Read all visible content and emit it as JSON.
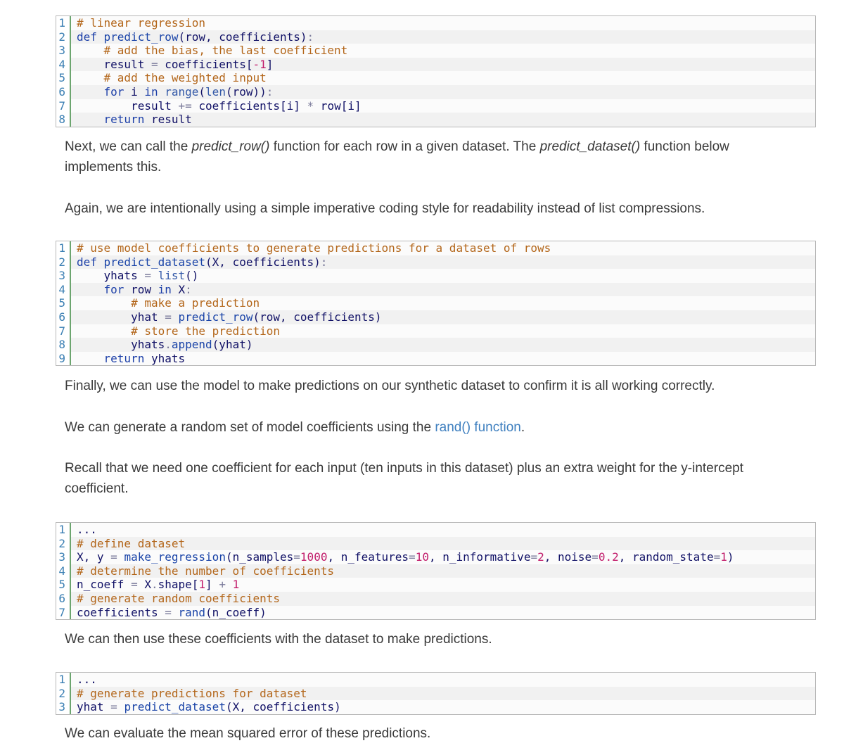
{
  "code_block_1": {
    "lines": [
      {
        "n": "1",
        "tokens": [
          {
            "t": "# linear regression",
            "c": "c"
          }
        ]
      },
      {
        "n": "2",
        "tokens": [
          {
            "t": "def ",
            "c": "k"
          },
          {
            "t": "predict_row",
            "c": "fn"
          },
          {
            "t": "(row, coefficients)",
            "c": "nm"
          },
          {
            "t": ":",
            "c": "p"
          }
        ]
      },
      {
        "n": "3",
        "tokens": [
          {
            "t": "    ",
            "c": "nm"
          },
          {
            "t": "# add the bias, the last coefficient",
            "c": "c"
          }
        ]
      },
      {
        "n": "4",
        "tokens": [
          {
            "t": "    result ",
            "c": "nm"
          },
          {
            "t": "=",
            "c": "p"
          },
          {
            "t": " coefficients[",
            "c": "nm"
          },
          {
            "t": "-1",
            "c": "num"
          },
          {
            "t": "]",
            "c": "nm"
          }
        ]
      },
      {
        "n": "5",
        "tokens": [
          {
            "t": "    ",
            "c": "nm"
          },
          {
            "t": "# add the weighted input",
            "c": "c"
          }
        ]
      },
      {
        "n": "6",
        "tokens": [
          {
            "t": "    ",
            "c": "nm"
          },
          {
            "t": "for ",
            "c": "k"
          },
          {
            "t": "i ",
            "c": "nm"
          },
          {
            "t": "in ",
            "c": "k"
          },
          {
            "t": "range",
            "c": "b"
          },
          {
            "t": "(",
            "c": "nm"
          },
          {
            "t": "len",
            "c": "b"
          },
          {
            "t": "(row))",
            "c": "nm"
          },
          {
            "t": ":",
            "c": "p"
          }
        ]
      },
      {
        "n": "7",
        "tokens": [
          {
            "t": "        result ",
            "c": "nm"
          },
          {
            "t": "+=",
            "c": "p"
          },
          {
            "t": " coefficients[i] ",
            "c": "nm"
          },
          {
            "t": "*",
            "c": "p"
          },
          {
            "t": " row[i]",
            "c": "nm"
          }
        ]
      },
      {
        "n": "8",
        "tokens": [
          {
            "t": "    ",
            "c": "nm"
          },
          {
            "t": "return ",
            "c": "k"
          },
          {
            "t": "result",
            "c": "nm"
          }
        ]
      }
    ]
  },
  "paragraphs_1": {
    "p1_before1": "Next, we can call the ",
    "p1_em1": "predict_row()",
    "p1_mid": " function for each row in a given dataset. The ",
    "p1_em2": "predict_dataset()",
    "p1_after": " function below implements this.",
    "p2": "Again, we are intentionally using a simple imperative coding style for readability instead of list compressions."
  },
  "code_block_2": {
    "lines": [
      {
        "n": "1",
        "tokens": [
          {
            "t": "# use model coefficients to generate predictions for a dataset of rows",
            "c": "c"
          }
        ]
      },
      {
        "n": "2",
        "tokens": [
          {
            "t": "def ",
            "c": "k"
          },
          {
            "t": "predict_dataset",
            "c": "fn"
          },
          {
            "t": "(X, coefficients)",
            "c": "nm"
          },
          {
            "t": ":",
            "c": "p"
          }
        ]
      },
      {
        "n": "3",
        "tokens": [
          {
            "t": "    yhats ",
            "c": "nm"
          },
          {
            "t": "=",
            "c": "p"
          },
          {
            "t": " ",
            "c": "nm"
          },
          {
            "t": "list",
            "c": "b"
          },
          {
            "t": "()",
            "c": "nm"
          }
        ]
      },
      {
        "n": "4",
        "tokens": [
          {
            "t": "    ",
            "c": "nm"
          },
          {
            "t": "for ",
            "c": "k"
          },
          {
            "t": "row ",
            "c": "nm"
          },
          {
            "t": "in ",
            "c": "k"
          },
          {
            "t": "X",
            "c": "nm"
          },
          {
            "t": ":",
            "c": "p"
          }
        ]
      },
      {
        "n": "5",
        "tokens": [
          {
            "t": "        ",
            "c": "nm"
          },
          {
            "t": "# make a prediction",
            "c": "c"
          }
        ]
      },
      {
        "n": "6",
        "tokens": [
          {
            "t": "        yhat ",
            "c": "nm"
          },
          {
            "t": "=",
            "c": "p"
          },
          {
            "t": " ",
            "c": "nm"
          },
          {
            "t": "predict_row",
            "c": "fn"
          },
          {
            "t": "(row, coefficients)",
            "c": "nm"
          }
        ]
      },
      {
        "n": "7",
        "tokens": [
          {
            "t": "        ",
            "c": "nm"
          },
          {
            "t": "# store the prediction",
            "c": "c"
          }
        ]
      },
      {
        "n": "8",
        "tokens": [
          {
            "t": "        yhats",
            "c": "nm"
          },
          {
            "t": ".",
            "c": "p"
          },
          {
            "t": "append",
            "c": "fn"
          },
          {
            "t": "(yhat)",
            "c": "nm"
          }
        ]
      },
      {
        "n": "9",
        "tokens": [
          {
            "t": "    ",
            "c": "nm"
          },
          {
            "t": "return ",
            "c": "k"
          },
          {
            "t": "yhats",
            "c": "nm"
          }
        ]
      }
    ]
  },
  "paragraphs_2": {
    "p3": "Finally, we can use the model to make predictions on our synthetic dataset to confirm it is all working correctly.",
    "p4_before": "We can generate a random set of model coefficients using the ",
    "p4_link": "rand() function",
    "p4_after": ".",
    "p5": "Recall that we need one coefficient for each input (ten inputs in this dataset) plus an extra weight for the y-intercept coefficient."
  },
  "code_block_3": {
    "lines": [
      {
        "n": "1",
        "tokens": [
          {
            "t": "...",
            "c": "nm"
          }
        ]
      },
      {
        "n": "2",
        "tokens": [
          {
            "t": "# define dataset",
            "c": "c"
          }
        ]
      },
      {
        "n": "3",
        "tokens": [
          {
            "t": "X, y ",
            "c": "nm"
          },
          {
            "t": "=",
            "c": "p"
          },
          {
            "t": " ",
            "c": "nm"
          },
          {
            "t": "make_regression",
            "c": "fn"
          },
          {
            "t": "(n_samples",
            "c": "nm"
          },
          {
            "t": "=",
            "c": "p"
          },
          {
            "t": "1000",
            "c": "num"
          },
          {
            "t": ", n_features",
            "c": "nm"
          },
          {
            "t": "=",
            "c": "p"
          },
          {
            "t": "10",
            "c": "num"
          },
          {
            "t": ", n_informative",
            "c": "nm"
          },
          {
            "t": "=",
            "c": "p"
          },
          {
            "t": "2",
            "c": "num"
          },
          {
            "t": ", noise",
            "c": "nm"
          },
          {
            "t": "=",
            "c": "p"
          },
          {
            "t": "0.2",
            "c": "num"
          },
          {
            "t": ", random_state",
            "c": "nm"
          },
          {
            "t": "=",
            "c": "p"
          },
          {
            "t": "1",
            "c": "num"
          },
          {
            "t": ")",
            "c": "nm"
          }
        ]
      },
      {
        "n": "4",
        "tokens": [
          {
            "t": "# determine the number of coefficients",
            "c": "c"
          }
        ]
      },
      {
        "n": "5",
        "tokens": [
          {
            "t": "n_coeff ",
            "c": "nm"
          },
          {
            "t": "=",
            "c": "p"
          },
          {
            "t": " X",
            "c": "nm"
          },
          {
            "t": ".",
            "c": "p"
          },
          {
            "t": "shape[",
            "c": "nm"
          },
          {
            "t": "1",
            "c": "num"
          },
          {
            "t": "] ",
            "c": "nm"
          },
          {
            "t": "+",
            "c": "p"
          },
          {
            "t": " ",
            "c": "nm"
          },
          {
            "t": "1",
            "c": "num"
          }
        ]
      },
      {
        "n": "6",
        "tokens": [
          {
            "t": "# generate random coefficients",
            "c": "c"
          }
        ]
      },
      {
        "n": "7",
        "tokens": [
          {
            "t": "coefficients ",
            "c": "nm"
          },
          {
            "t": "=",
            "c": "p"
          },
          {
            "t": " ",
            "c": "nm"
          },
          {
            "t": "rand",
            "c": "fn"
          },
          {
            "t": "(n_coeff)",
            "c": "nm"
          }
        ]
      }
    ]
  },
  "paragraphs_3": {
    "p6": "We can then use these coefficients with the dataset to make predictions."
  },
  "code_block_4": {
    "lines": [
      {
        "n": "1",
        "tokens": [
          {
            "t": "...",
            "c": "nm"
          }
        ]
      },
      {
        "n": "2",
        "tokens": [
          {
            "t": "# generate predictions for dataset",
            "c": "c"
          }
        ]
      },
      {
        "n": "3",
        "tokens": [
          {
            "t": "yhat ",
            "c": "nm"
          },
          {
            "t": "=",
            "c": "p"
          },
          {
            "t": " ",
            "c": "nm"
          },
          {
            "t": "predict_dataset",
            "c": "fn"
          },
          {
            "t": "(X, coefficients)",
            "c": "nm"
          }
        ]
      }
    ]
  },
  "paragraphs_4": {
    "p7": "We can evaluate the mean squared error of these predictions."
  }
}
